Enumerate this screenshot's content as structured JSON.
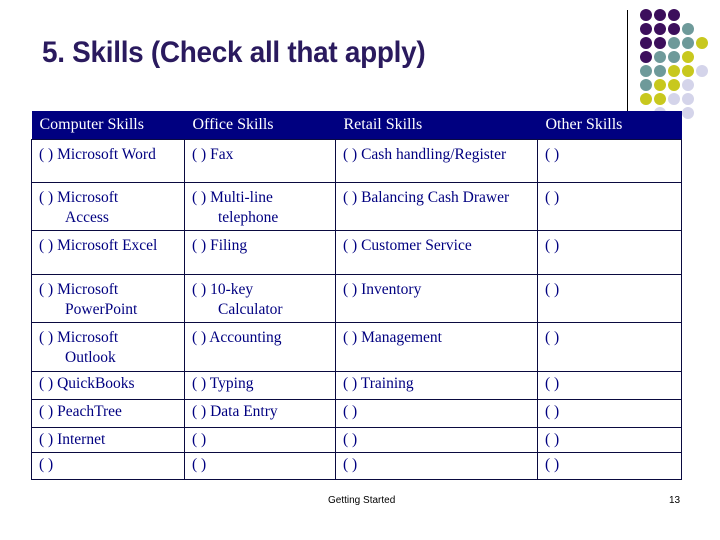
{
  "slide": {
    "title": "5. Skills (Check all that apply)",
    "footer_center": "Getting Started",
    "page_number": "13"
  },
  "colors": {
    "title": "#2a1a5e",
    "header_bg": "#000080",
    "cell_text": "#000080",
    "dot_purple": "#3c0f5c",
    "dot_teal": "#6e9a9a",
    "dot_yellow": "#c8c81e",
    "dot_lavender": "#d4d4ea"
  },
  "decoration": {
    "dot_grid": [
      "PPP__",
      "PPPT_",
      "PPTTY",
      "PTTY_",
      "TTYYL",
      "TYYL_",
      "YYLL_",
      "_L_L_"
    ]
  },
  "table": {
    "headers": [
      "Computer Skills",
      "Office Skills",
      "Retail Skills",
      "Other Skills"
    ],
    "rows": [
      [
        [
          "( ) Microsoft Word"
        ],
        [
          "( ) Fax"
        ],
        [
          "( ) Cash handling/Register"
        ],
        [
          "( )"
        ]
      ],
      [
        [
          "( ) Microsoft",
          "Access"
        ],
        [
          "( ) Multi-line",
          "telephone"
        ],
        [
          "( ) Balancing Cash Drawer"
        ],
        [
          "( )"
        ]
      ],
      [
        [
          "( ) Microsoft Excel"
        ],
        [
          "( ) Filing"
        ],
        [
          "( ) Customer Service"
        ],
        [
          "( )"
        ]
      ],
      [
        [
          "( ) Microsoft",
          "PowerPoint"
        ],
        [
          "( ) 10-key",
          "Calculator"
        ],
        [
          "( ) Inventory"
        ],
        [
          "( )"
        ]
      ],
      [
        [
          "( ) Microsoft",
          "Outlook"
        ],
        [
          "( ) Accounting"
        ],
        [
          "( ) Management"
        ],
        [
          "( )"
        ]
      ],
      [
        [
          "( ) QuickBooks"
        ],
        [
          "( ) Typing"
        ],
        [
          "( ) Training"
        ],
        [
          "( )"
        ]
      ],
      [
        [
          "( ) PeachTree"
        ],
        [
          "( ) Data Entry"
        ],
        [
          "( )"
        ],
        [
          "( )"
        ]
      ],
      [
        [
          "( ) Internet"
        ],
        [
          "( )"
        ],
        [
          "( )"
        ],
        [
          "( )"
        ]
      ],
      [
        [
          "( )"
        ],
        [
          "( )"
        ],
        [
          "( )"
        ],
        [
          "( )"
        ]
      ]
    ]
  }
}
